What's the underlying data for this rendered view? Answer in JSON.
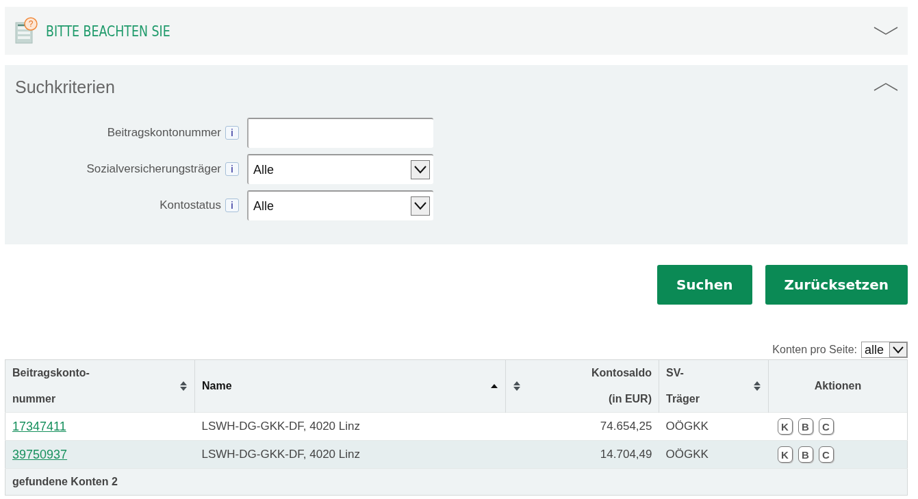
{
  "notice": {
    "badge": "?",
    "title": "BITTE BEACHTEN SIE",
    "expanded": false
  },
  "search": {
    "title": "Suchkriterien",
    "expanded": true,
    "fields": [
      {
        "kind": "text",
        "label": "Beitragskontonummer",
        "info": "i"
      },
      {
        "kind": "select",
        "label": "Sozialversicherungsträger",
        "info": "i",
        "value": "Alle"
      },
      {
        "kind": "select",
        "label": "Kontostatus",
        "info": "i",
        "value": "Alle"
      }
    ]
  },
  "buttons": [
    "Suchen",
    "Zurücksetzen"
  ],
  "page_size": {
    "label": "Konten pro Seite:",
    "value": "alle"
  },
  "table": {
    "columns": [
      {
        "label": "Beitragskonto-\nnummer",
        "kind": "sortable"
      },
      {
        "label": "Name",
        "kind": "sorted_asc"
      },
      {
        "label": "Kontosaldo\n(in EUR)",
        "kind": "sortable_numeric"
      },
      {
        "label": "SV-\nTräger",
        "kind": "sortable"
      },
      {
        "label": "Aktionen",
        "kind": "plain"
      }
    ],
    "rows": [
      {
        "number": "17347411",
        "name": "LSWH-DG-GKK-DF, 4020 Linz",
        "balance": "74.654,25",
        "carrier": "OÖGKK",
        "actions": [
          "K",
          "B",
          "C"
        ]
      },
      {
        "number": "39750937",
        "name": "LSWH-DG-GKK-DF, 4020 Linz",
        "balance": "14.704,49",
        "carrier": "OÖGKK",
        "actions": [
          "K",
          "B",
          "C"
        ]
      }
    ],
    "footer": "gefundene Konten 2"
  }
}
